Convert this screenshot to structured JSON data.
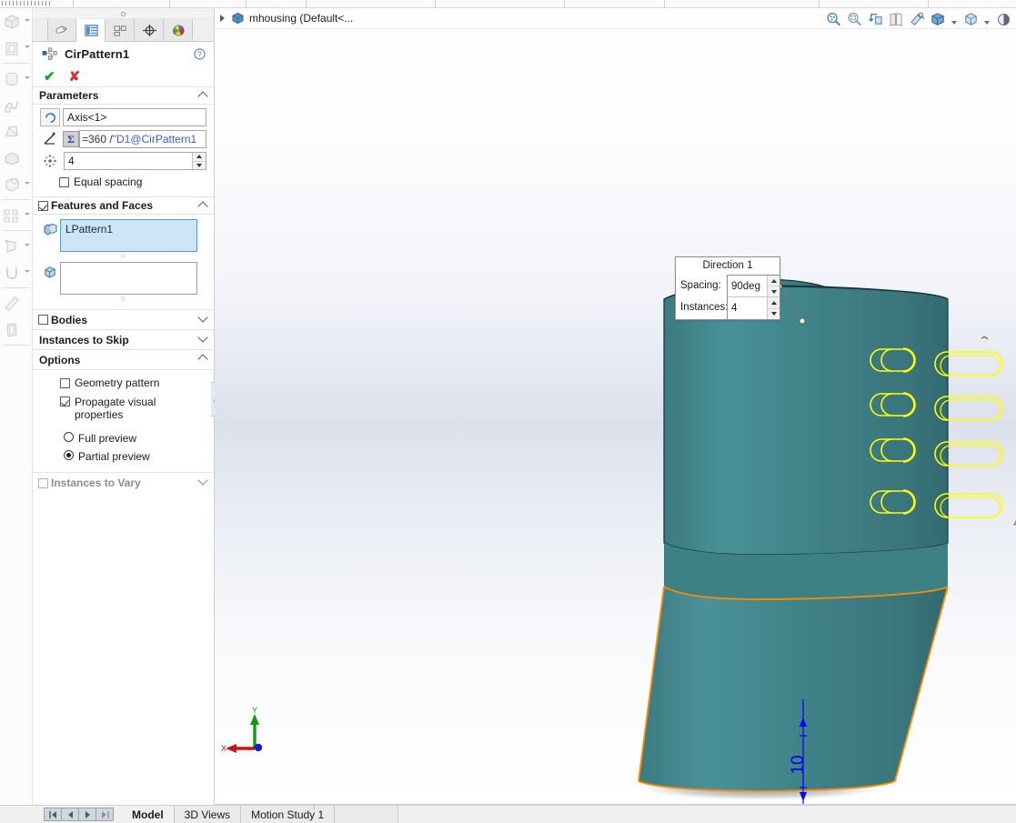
{
  "window": {
    "document_tab_label": "mhousing  (Default<...",
    "document_icon": "part-cube-icon"
  },
  "property_manager": {
    "tabs": [
      {
        "name": "feature-manager-design-tree-tab",
        "icon": "design-tree-icon",
        "active": false
      },
      {
        "name": "property-manager-tab",
        "icon": "property-manager-icon",
        "active": true
      },
      {
        "name": "configuration-manager-tab",
        "icon": "configuration-manager-icon",
        "active": false
      },
      {
        "name": "dimxpert-manager-tab",
        "icon": "dimxpert-icon",
        "active": false
      },
      {
        "name": "display-manager-tab",
        "icon": "display-manager-icon",
        "active": false
      }
    ],
    "title": "CirPattern1",
    "title_icon": "circular-pattern-icon",
    "help_icon": "help-question-icon",
    "accept_label": "✔",
    "cancel_label": "✘",
    "sections": {
      "parameters": {
        "label": "Parameters",
        "axis_icon": "rotation-axis-icon",
        "axis_value": "Axis<1>",
        "angle_icon": "angle-dimension-icon",
        "sigma_symbol": "Σ",
        "angle_formula_prefix": "=360 / ",
        "angle_formula_ref": "\"D1@CirPattern1",
        "instances_icon": "number-of-instances-icon",
        "instances_value": "4",
        "equal_spacing_label": "Equal spacing",
        "equal_spacing_checked": false
      },
      "features_and_faces": {
        "label": "Features and Faces",
        "checked": true,
        "features_icon": "features-selection-icon",
        "features_value": "LPattern1",
        "faces_icon": "faces-selection-icon",
        "faces_value": ""
      },
      "bodies": {
        "label": "Bodies",
        "checked": false,
        "collapsed": true
      },
      "instances_to_skip": {
        "label": "Instances to Skip",
        "collapsed": true
      },
      "options": {
        "label": "Options",
        "geometry_pattern_label": "Geometry pattern",
        "geometry_pattern_checked": false,
        "propagate_label": "Propagate visual properties",
        "propagate_label_line1": "Propagate visual",
        "propagate_label_line2": "properties",
        "propagate_checked": true,
        "full_preview_label": "Full preview",
        "partial_preview_label": "Partial preview",
        "preview_selected": "Partial preview"
      },
      "instances_to_vary": {
        "label": "Instances to Vary",
        "checked": false,
        "collapsed": true
      }
    }
  },
  "view_toolbar": {
    "items": [
      {
        "name": "zoom-to-fit-icon"
      },
      {
        "name": "zoom-to-area-icon"
      },
      {
        "name": "previous-view-icon"
      },
      {
        "name": "section-view-icon"
      },
      {
        "name": "view-orientation-icon"
      },
      {
        "name": "display-style-icon",
        "has_caret": true
      },
      {
        "name": "hide-show-items-icon",
        "has_caret": true
      },
      {
        "name": "edit-appearance-icon",
        "has_caret": true
      }
    ]
  },
  "graphics": {
    "direction_callout": {
      "title": "Direction 1",
      "spacing_label": "Spacing:",
      "spacing_value": "90deg",
      "instances_label": "Instances:",
      "instances_value": "4"
    },
    "dimension_label": "10",
    "model": {
      "body_color": "#3d8085",
      "body_color_light": "#4a9299",
      "body_color_dark": "#2f686d",
      "preview_edge_color": "#ffff00",
      "selected_edge_color": "#ff8c00",
      "axis_color": "#3a8fd4",
      "dimension_color": "#0000ff",
      "slot_rows": 4,
      "slot_columns_visible": 4
    },
    "triad": {
      "x_label": "X",
      "y_label": "Y",
      "x_color": "#cc0000",
      "y_color": "#009900",
      "z_color": "#0000cc"
    }
  },
  "status_bar": {
    "nav_first": "◀◀",
    "nav_prev": "◀",
    "nav_next": "▶",
    "nav_last": "▶▶",
    "tabs": [
      {
        "label": "Model",
        "active": true
      },
      {
        "label": "3D Views",
        "active": false
      },
      {
        "label": "Motion Study 1",
        "active": false
      }
    ]
  }
}
